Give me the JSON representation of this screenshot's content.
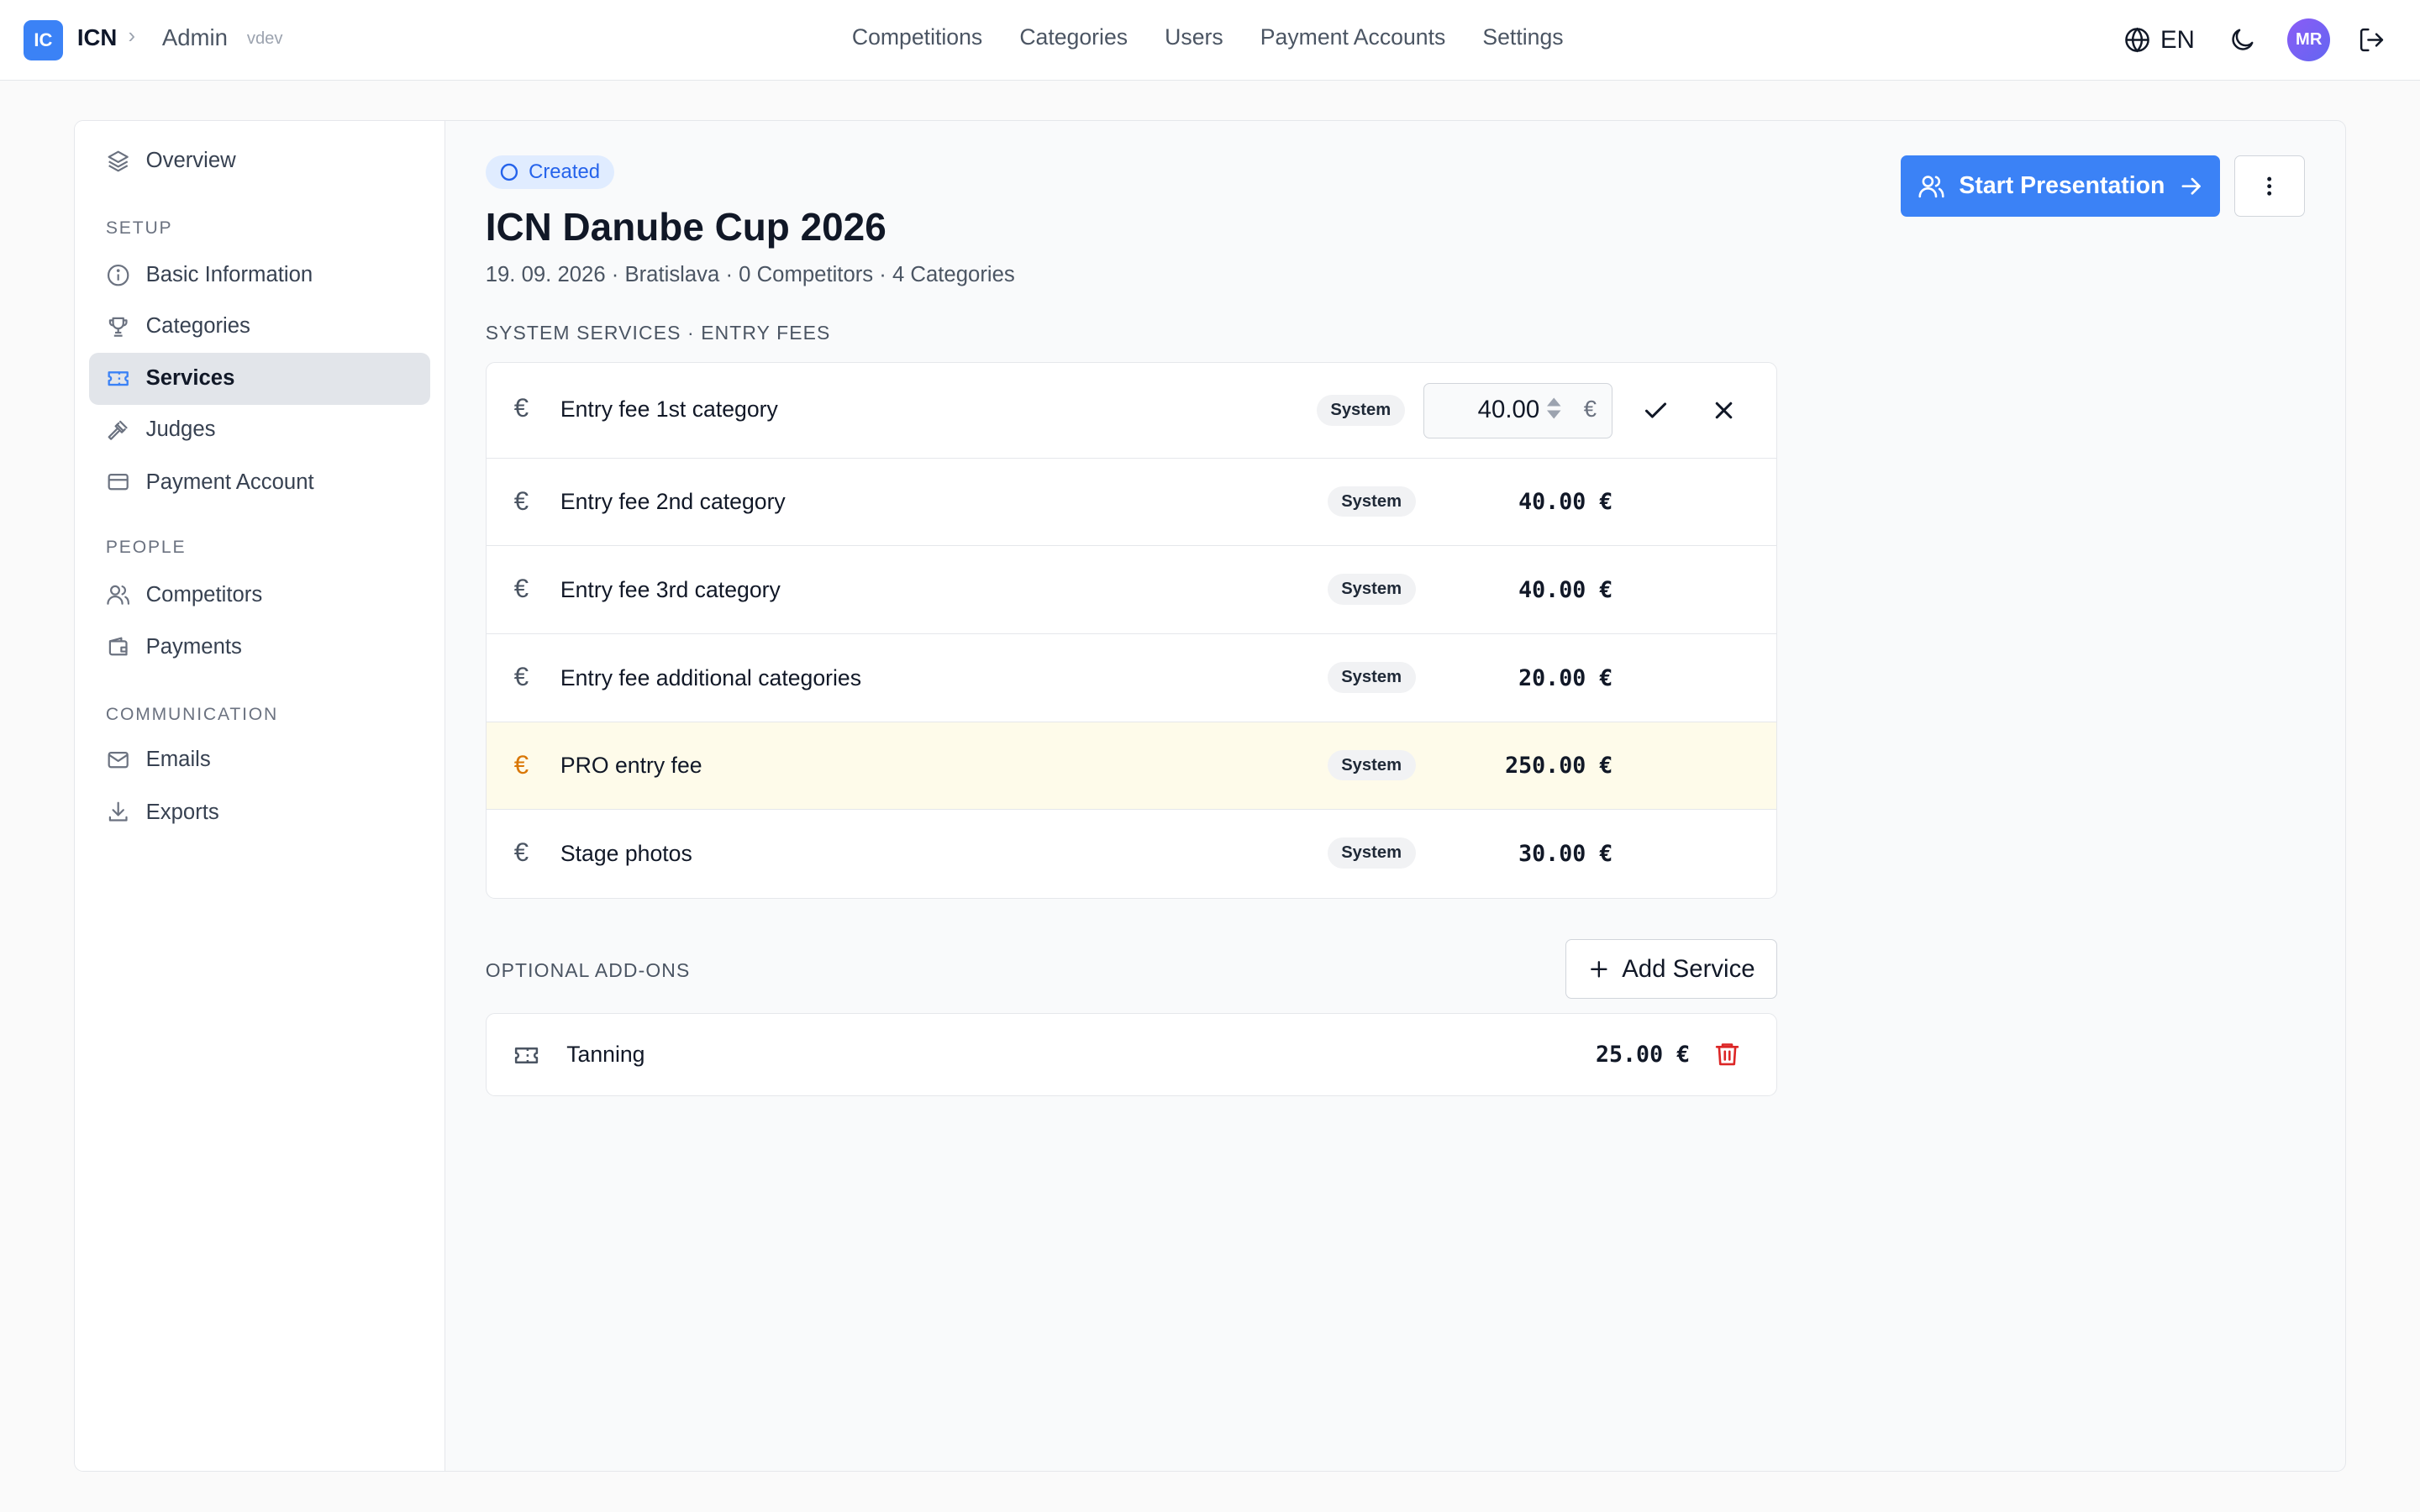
{
  "header": {
    "logo_text": "IC",
    "brand": "ICN",
    "breadcrumb_sep": "›",
    "section": "Admin",
    "env": "vdev",
    "nav": [
      "Competitions",
      "Categories",
      "Users",
      "Payment Accounts",
      "Settings"
    ],
    "language": "EN",
    "avatar": "MR"
  },
  "sidebar": {
    "overview": "Overview",
    "setup_heading": "SETUP",
    "setup_items": [
      "Basic Information",
      "Categories",
      "Services",
      "Judges",
      "Payment Account"
    ],
    "people_heading": "PEOPLE",
    "people_items": [
      "Competitors",
      "Payments"
    ],
    "communication_heading": "COMMUNICATION",
    "communication_items": [
      "Emails",
      "Exports"
    ],
    "active_item": "Services"
  },
  "competition": {
    "status": "Created",
    "title": "ICN Danube Cup 2026",
    "meta": "19. 09. 2026 · Bratislava · 0 Competitors · 4 Categories",
    "start_button": "Start Presentation"
  },
  "system_services": {
    "heading": "SYSTEM SERVICES · ENTRY FEES",
    "badge": "System",
    "currency_symbol": "€",
    "items": [
      {
        "label": "Entry fee 1st category",
        "price": "40.00 €",
        "edit_value": "40.00",
        "editing": true
      },
      {
        "label": "Entry fee 2nd category",
        "price": "40.00 €"
      },
      {
        "label": "Entry fee 3rd category",
        "price": "40.00 €"
      },
      {
        "label": "Entry fee additional categories",
        "price": "20.00 €"
      },
      {
        "label": "PRO entry fee",
        "price": "250.00 €",
        "highlighted": true
      },
      {
        "label": "Stage photos",
        "price": "30.00 €"
      }
    ]
  },
  "optional_addons": {
    "heading": "OPTIONAL ADD-ONS",
    "add_button": "Add Service",
    "items": [
      {
        "label": "Tanning",
        "price": "25.00 €"
      }
    ]
  },
  "colors": {
    "accent": "#3b82f6",
    "highlight_row": "#fefbea",
    "highlight_icon": "#d97706",
    "danger": "#dc2626"
  }
}
